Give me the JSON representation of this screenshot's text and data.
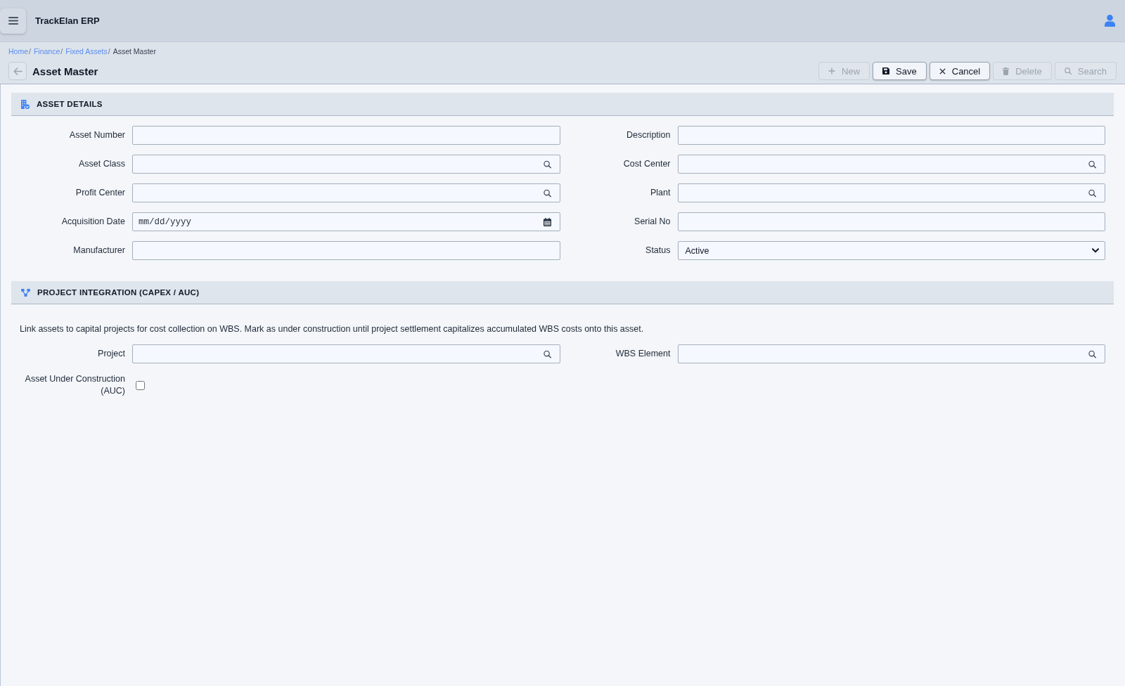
{
  "app_bar": {
    "title": "TrackElan ERP"
  },
  "breadcrumb": {
    "separator": "/",
    "items": [
      {
        "label": "Home",
        "kind": "link"
      },
      {
        "label": "Finance",
        "kind": "link"
      },
      {
        "label": "Fixed Assets",
        "kind": "link"
      },
      {
        "label": "Asset Master",
        "kind": "current"
      }
    ]
  },
  "page": {
    "title": "Asset Master"
  },
  "toolbar": [
    {
      "label": "New",
      "kind": "new",
      "disabled": true
    },
    {
      "label": "Save",
      "kind": "save",
      "disabled": false
    },
    {
      "label": "Cancel",
      "kind": "cancel",
      "disabled": false
    },
    {
      "label": "Delete",
      "kind": "delete",
      "disabled": true
    },
    {
      "label": "Search",
      "kind": "search",
      "disabled": true
    }
  ],
  "sections": [
    {
      "title": "ASSET DETAILS",
      "fields": [
        {
          "label": "Asset Number",
          "kind": "text"
        },
        {
          "label": "Description",
          "kind": "text"
        },
        {
          "label": "Asset Class",
          "kind": "lookup"
        },
        {
          "label": "Cost Center",
          "kind": "lookup"
        },
        {
          "label": "Profit Center",
          "kind": "lookup"
        },
        {
          "label": "Plant",
          "kind": "lookup"
        },
        {
          "label": "Acquisition Date",
          "kind": "date",
          "placeholder": "mm/dd/yyyy"
        },
        {
          "label": "Serial No",
          "kind": "text"
        },
        {
          "label": "Manufacturer",
          "kind": "text"
        },
        {
          "label": "Status",
          "kind": "select",
          "value": "Active"
        }
      ]
    },
    {
      "title": "PROJECT INTEGRATION (CAPEX / AUC)",
      "description": "Link assets to capital projects for cost collection on WBS. Mark as under construction until project settlement capitalizes accumulated WBS costs onto this asset.",
      "fields": [
        {
          "label": "Project",
          "kind": "lookup"
        },
        {
          "label": "WBS Element",
          "kind": "lookup"
        },
        {
          "label": "Asset Under Construction (AUC)",
          "kind": "checkbox",
          "checked": false
        }
      ]
    }
  ]
}
